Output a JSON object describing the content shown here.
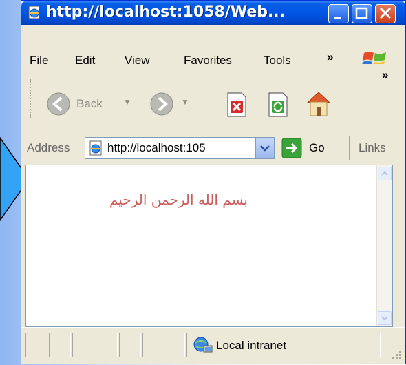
{
  "window": {
    "title": "http://localhost:1058/Web..."
  },
  "menu": {
    "items": [
      "File",
      "Edit",
      "View",
      "Favorites",
      "Tools"
    ],
    "overflow": "»"
  },
  "toolbar": {
    "back_label": "Back",
    "overflow": "»"
  },
  "address": {
    "label": "Address",
    "value": "http://localhost:105",
    "go_label": "Go",
    "links_label": "Links"
  },
  "content": {
    "arabic_text": "بسم الله الرحمن الرحيم"
  },
  "status": {
    "zone_label": "Local intranet"
  }
}
